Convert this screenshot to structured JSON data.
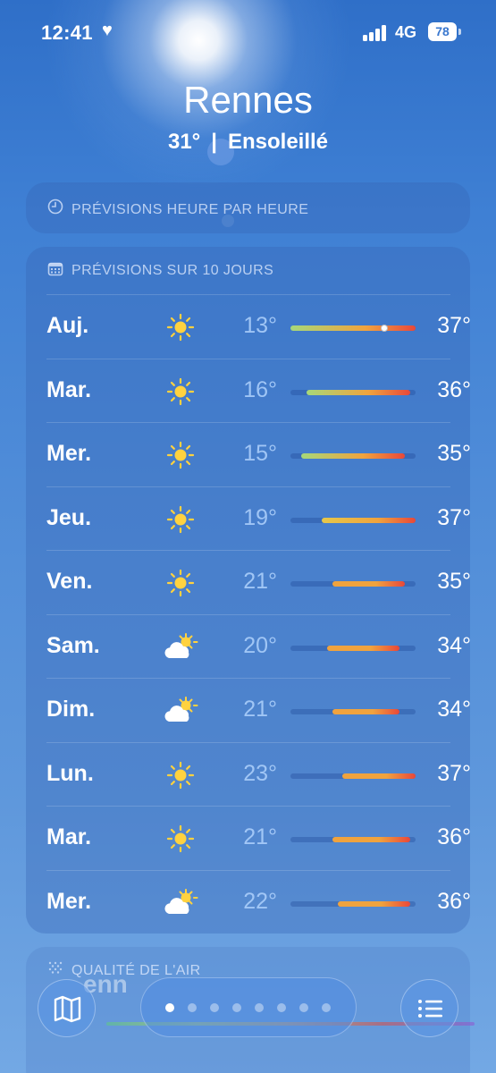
{
  "status": {
    "time": "12:41",
    "network": "4G",
    "battery": "78"
  },
  "header": {
    "city": "Rennes",
    "temperature": "31°",
    "separator": "|",
    "condition": "Ensoleillé"
  },
  "hourly": {
    "title": "PRÉVISIONS HEURE PAR HEURE",
    "icon": "clock-icon"
  },
  "daily": {
    "title": "PRÉVISIONS SUR 10 JOURS",
    "icon": "calendar-icon",
    "range_min": 13,
    "range_max": 37,
    "current_temp": 31,
    "days": [
      {
        "day": "Auj.",
        "icon": "sun",
        "low": "13°",
        "high": "37°",
        "low_val": 13,
        "high_val": 37
      },
      {
        "day": "Mar.",
        "icon": "sun",
        "low": "16°",
        "high": "36°",
        "low_val": 16,
        "high_val": 36
      },
      {
        "day": "Mer.",
        "icon": "sun",
        "low": "15°",
        "high": "35°",
        "low_val": 15,
        "high_val": 35
      },
      {
        "day": "Jeu.",
        "icon": "sun",
        "low": "19°",
        "high": "37°",
        "low_val": 19,
        "high_val": 37
      },
      {
        "day": "Ven.",
        "icon": "sun",
        "low": "21°",
        "high": "35°",
        "low_val": 21,
        "high_val": 35
      },
      {
        "day": "Sam.",
        "icon": "partly-cloudy",
        "low": "20°",
        "high": "34°",
        "low_val": 20,
        "high_val": 34
      },
      {
        "day": "Dim.",
        "icon": "partly-cloudy",
        "low": "21°",
        "high": "34°",
        "low_val": 21,
        "high_val": 34
      },
      {
        "day": "Lun.",
        "icon": "sun",
        "low": "23°",
        "high": "37°",
        "low_val": 23,
        "high_val": 37
      },
      {
        "day": "Mar.",
        "icon": "sun",
        "low": "21°",
        "high": "36°",
        "low_val": 21,
        "high_val": 36
      },
      {
        "day": "Mer.",
        "icon": "partly-cloudy",
        "low": "22°",
        "high": "36°",
        "low_val": 22,
        "high_val": 36
      }
    ]
  },
  "air_quality": {
    "title": "QUALITÉ DE L'AIR",
    "icon": "air-icon",
    "partial_text": "enn"
  },
  "bottom": {
    "pages": 8,
    "active_page": 0,
    "map_icon": "map-icon",
    "list_icon": "list-icon"
  },
  "colors": {
    "sky_top": "#2f6fc8",
    "sky_bottom": "#73a8e4",
    "sun": "#ffd23f",
    "bar_cool": "#a6d87a",
    "bar_warm": "#f0a33e",
    "bar_hot": "#e8483a"
  }
}
